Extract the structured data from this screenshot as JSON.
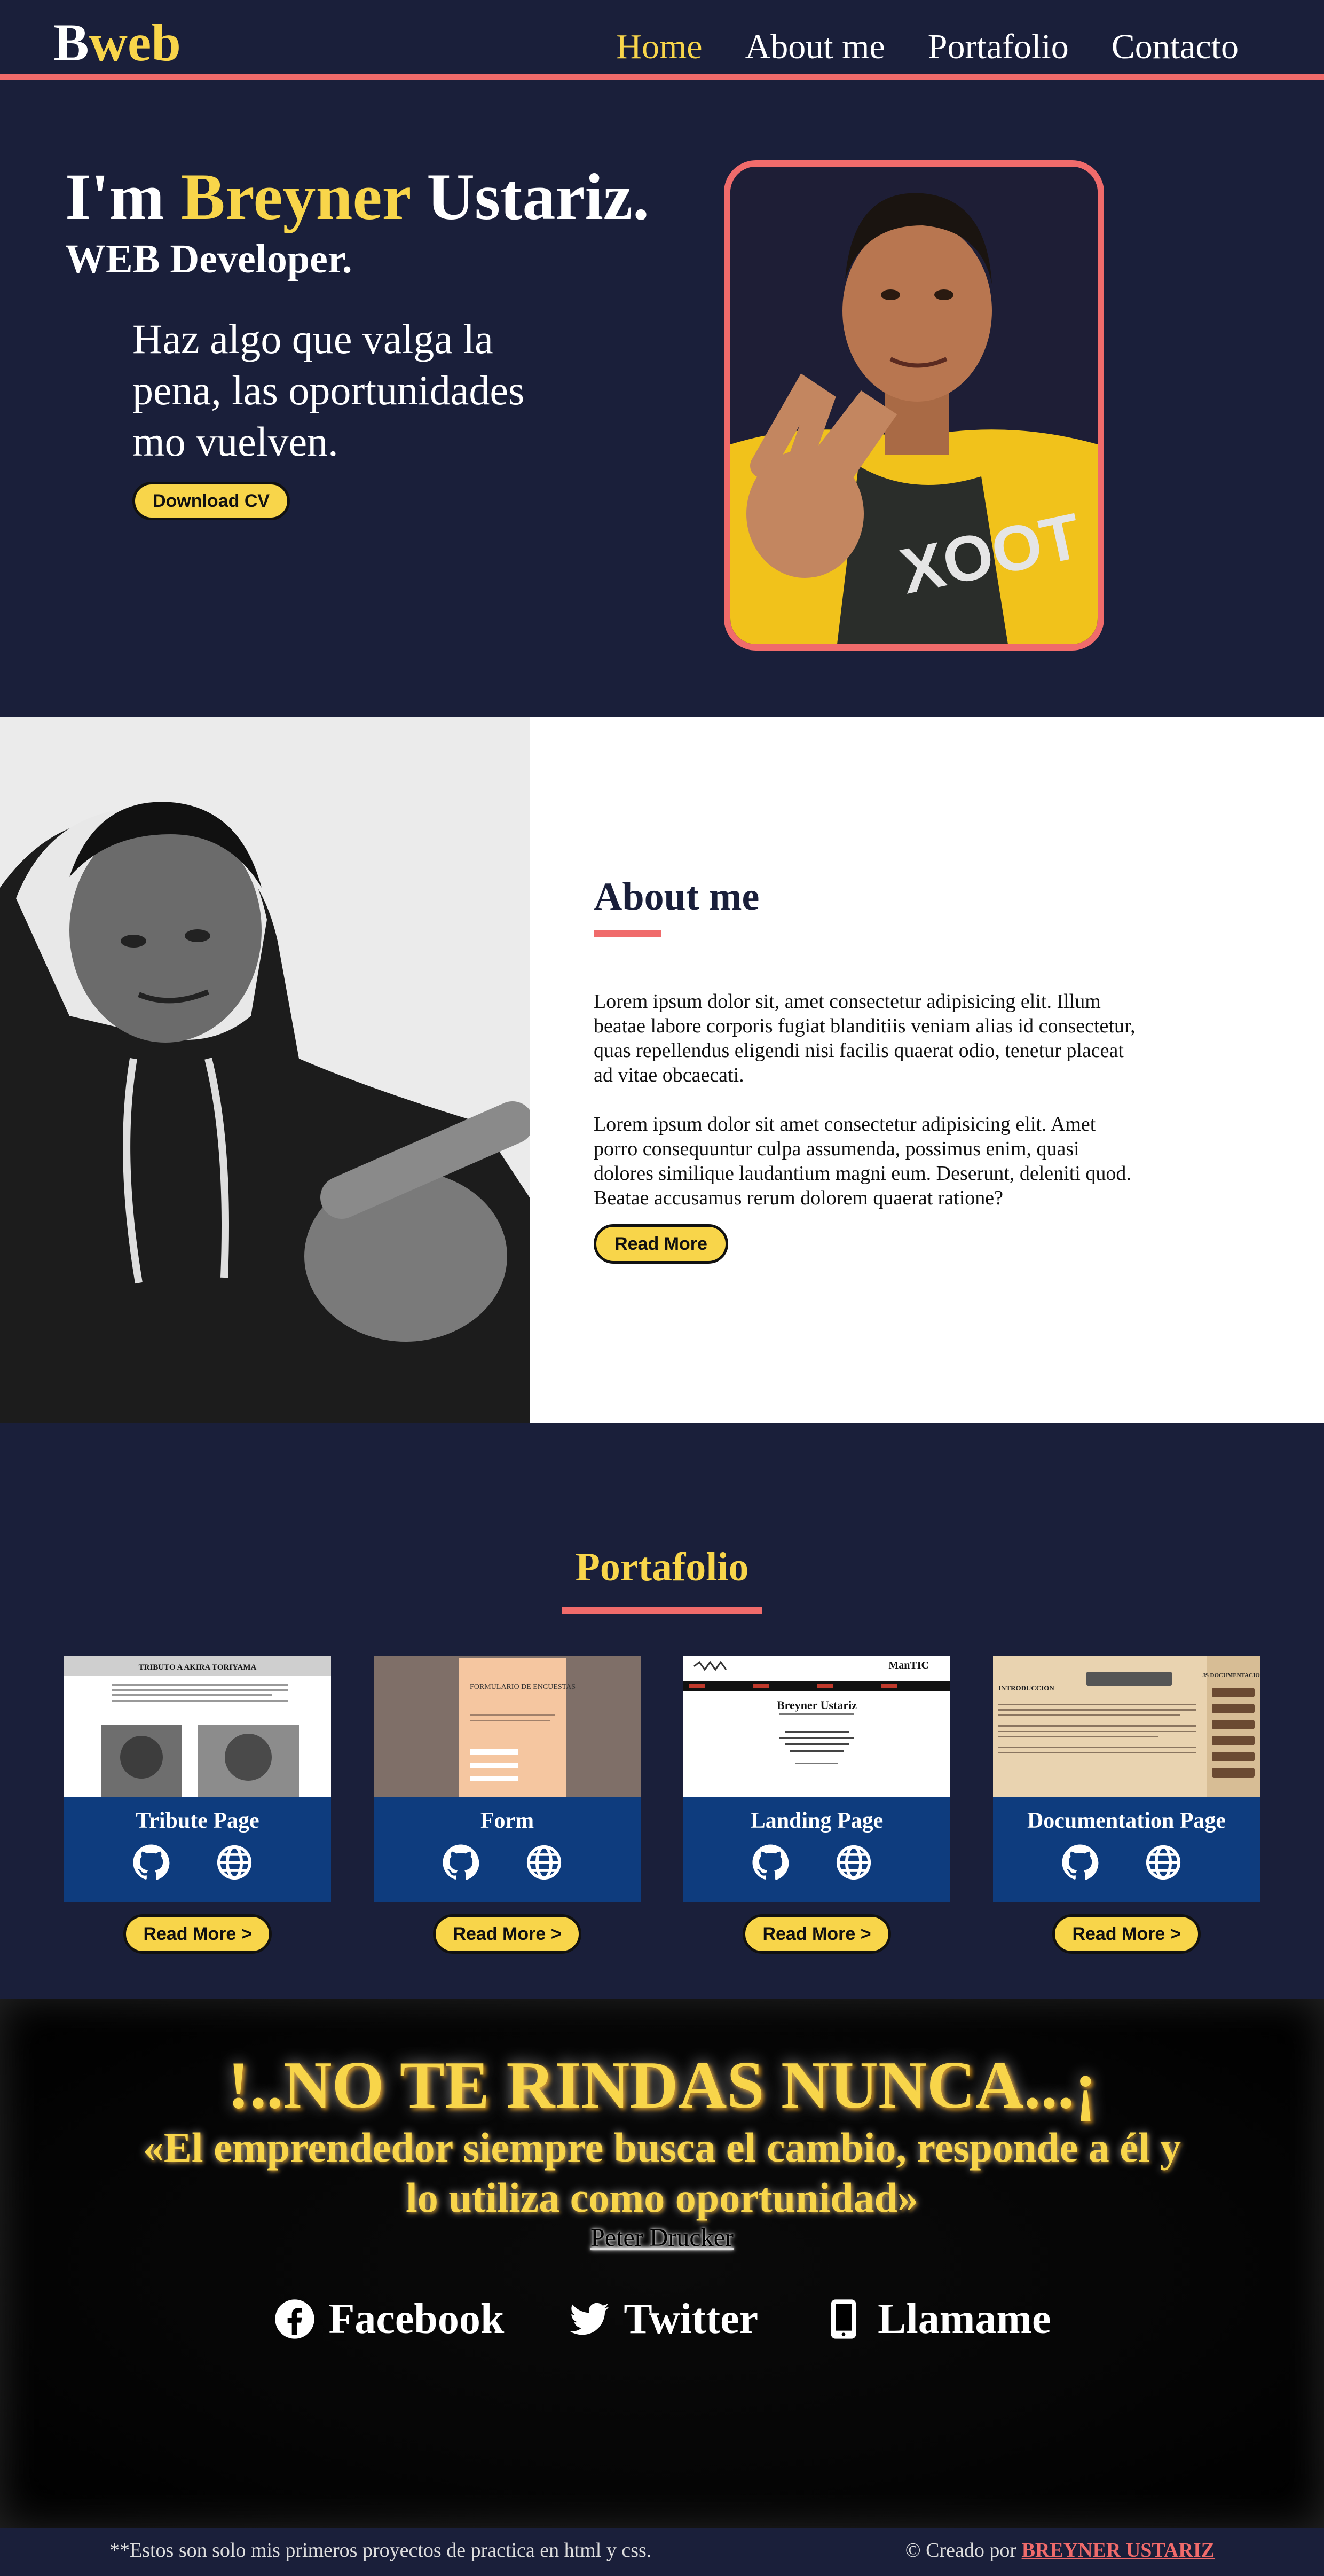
{
  "nav": {
    "logo_b": "B",
    "logo_rest": "web",
    "links": [
      "Home",
      "About me",
      "Portafolio",
      "Contacto"
    ]
  },
  "hero": {
    "title_prefix": "I'm",
    "title_name": "Breyner",
    "title_suffix": "Ustariz.",
    "subtitle": "WEB Developer.",
    "quote": "Haz algo que valga la pena, las oportunidades mo vuelven.",
    "download_label": "Download CV"
  },
  "about": {
    "title": "About me",
    "p1": "Lorem ipsum dolor sit, amet consectetur adipisicing elit. Illum beatae labore corporis fugiat blanditiis veniam alias id consectetur, quas repellendus eligendi nisi facilis quaerat odio, tenetur placeat ad vitae obcaecati.",
    "p2": "Lorem ipsum dolor sit amet consectetur adipisicing elit. Amet porro consequuntur culpa assumenda, possimus enim, quasi dolores similique laudantium magni eum. Deserunt, deleniti quod. Beatae accusamus rerum dolorem quaerat ratione?",
    "read_more": "Read More"
  },
  "portfolio": {
    "title": "Portafolio",
    "cards": [
      {
        "label": "Tribute Page",
        "button": "Read More >",
        "thumb_title": "TRIBUTO A AKIRA TORIYAMA"
      },
      {
        "label": "Form",
        "button": "Read More >",
        "thumb_title": "FORMULARIO DE ENCUESTAS"
      },
      {
        "label": "Landing Page",
        "button": "Read More >",
        "thumb_title": "Breyner Ustariz",
        "thumb_brand": "ManTIC"
      },
      {
        "label": "Documentation Page",
        "button": "Read More >",
        "thumb_title": "INTRODUCCION",
        "thumb_side": "JS DOCUMENTACION"
      }
    ]
  },
  "quote": {
    "main": "!..NO TE RINDAS NUNCA...¡",
    "text": "«El emprendedor siempre busca el cambio, responde a él y lo utiliza como oportunidad»",
    "author": "Peter Drucker",
    "social": [
      {
        "label": "Facebook",
        "icon": "facebook-icon"
      },
      {
        "label": "Twitter",
        "icon": "twitter-icon"
      },
      {
        "label": "Llamame",
        "icon": "phone-icon"
      }
    ]
  },
  "footer": {
    "note": "**Estos son solo mis primeros proyectos de practica en html y css.",
    "credit_prefix": "© Creado por",
    "credit_name": "BREYNER USTARIZ"
  },
  "colors": {
    "navy": "#1a1f3a",
    "accent_yellow": "#f8d54a",
    "accent_coral": "#f06b6b",
    "card_blue": "#0e3c7e"
  }
}
